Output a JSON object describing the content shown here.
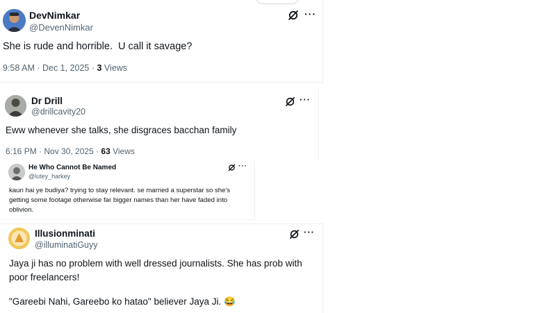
{
  "tweets": [
    {
      "name": "DevNimkar",
      "handle": "@DevenNimkar",
      "text": "She is rude and horrible.  U call it savage?",
      "time": "9:58 AM · Dec 1, 2025 · ",
      "views_count": "3",
      "views_label": " Views",
      "avatar_color": "#3d6db5"
    },
    {
      "name": "Dr Drill",
      "handle": "@drillcavity20",
      "text": "Eww whenever she talks, she disgraces bacchan family",
      "time": "6:16 PM · Nov 30, 2025 · ",
      "views_count": "63",
      "views_label": " Views",
      "avatar_color": "#5b5f5a"
    },
    {
      "name": "He Who Cannot Be Named",
      "handle": "@lutey_harkey",
      "text": "kaun hai ye budiya? trying to stay relevant. se married a superstar so she's getting some footage otherwise far bigger names than her have faded into oblivion.",
      "avatar_color": "#8c8f8f"
    },
    {
      "name": "Illusionminati",
      "handle": "@illuminatiGuyy",
      "text": "Jaya ji has no problem with well dressed journalists. She has prob with poor freelancers!",
      "text2": "\"Gareebi Nahi, Gareebo ko hatao\" believer Jaya Ji. 😂",
      "avatar_color": "#e8b949"
    }
  ],
  "icons": {
    "grok": "grok-icon",
    "more": "more-options-icon"
  },
  "more_glyph": "···"
}
